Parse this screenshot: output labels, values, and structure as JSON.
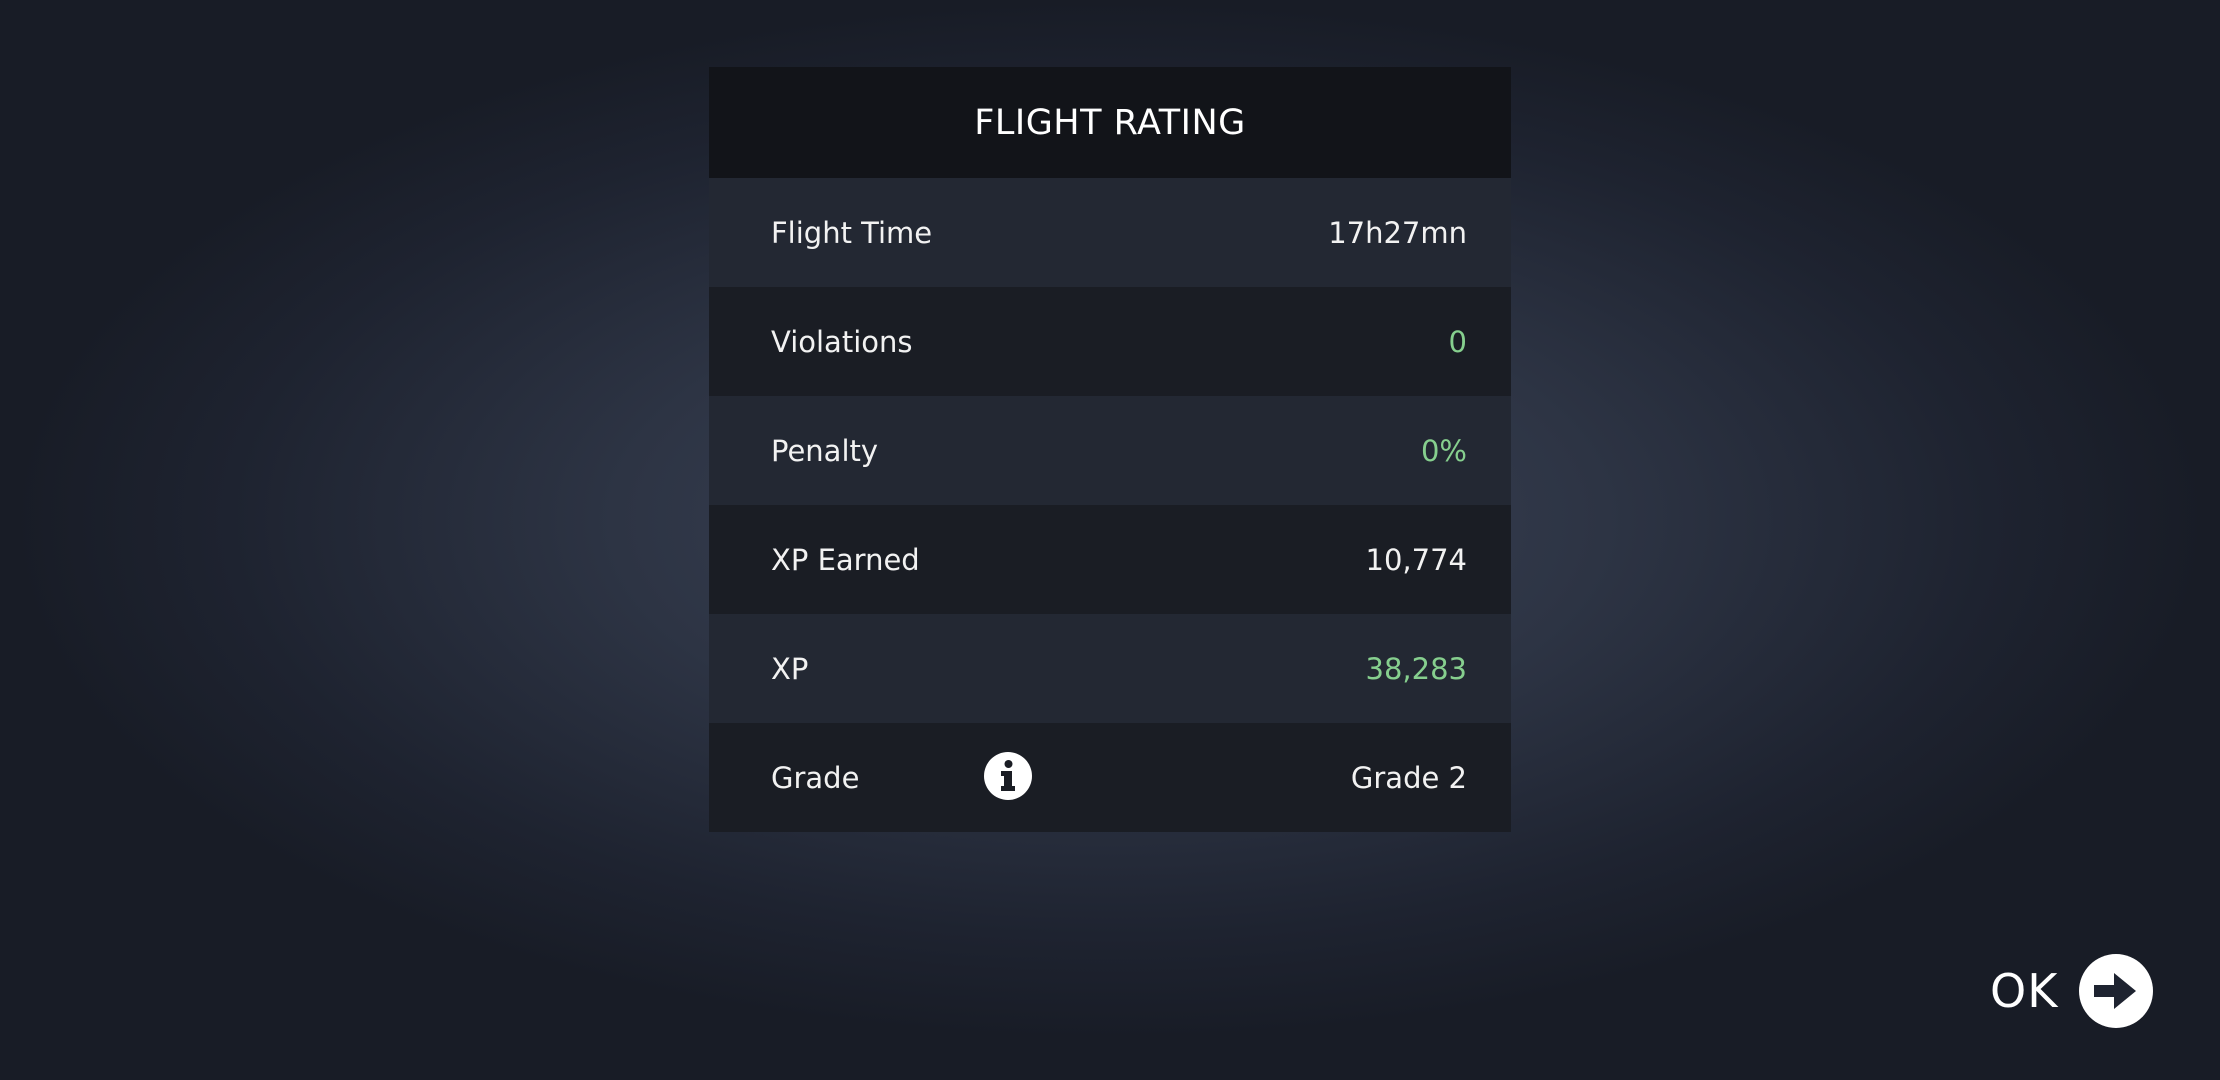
{
  "panel": {
    "title": "FLIGHT RATING",
    "rows": [
      {
        "label": "Flight Time",
        "value": "17h27mn"
      },
      {
        "label": "Violations",
        "value": "0"
      },
      {
        "label": "Penalty",
        "value": "0%"
      },
      {
        "label": "XP Earned",
        "value": "10,774"
      },
      {
        "label": "XP",
        "value": "38,283"
      },
      {
        "label": "Grade",
        "value": "Grade 2",
        "icon": "info-icon"
      }
    ]
  },
  "ok_button": {
    "label": "OK",
    "icon": "arrow-right-circle-icon"
  },
  "colors": {
    "positive": "#86cf8e",
    "header_bg": "#121419",
    "row_light": "#232833",
    "row_dark": "#1a1d24"
  }
}
